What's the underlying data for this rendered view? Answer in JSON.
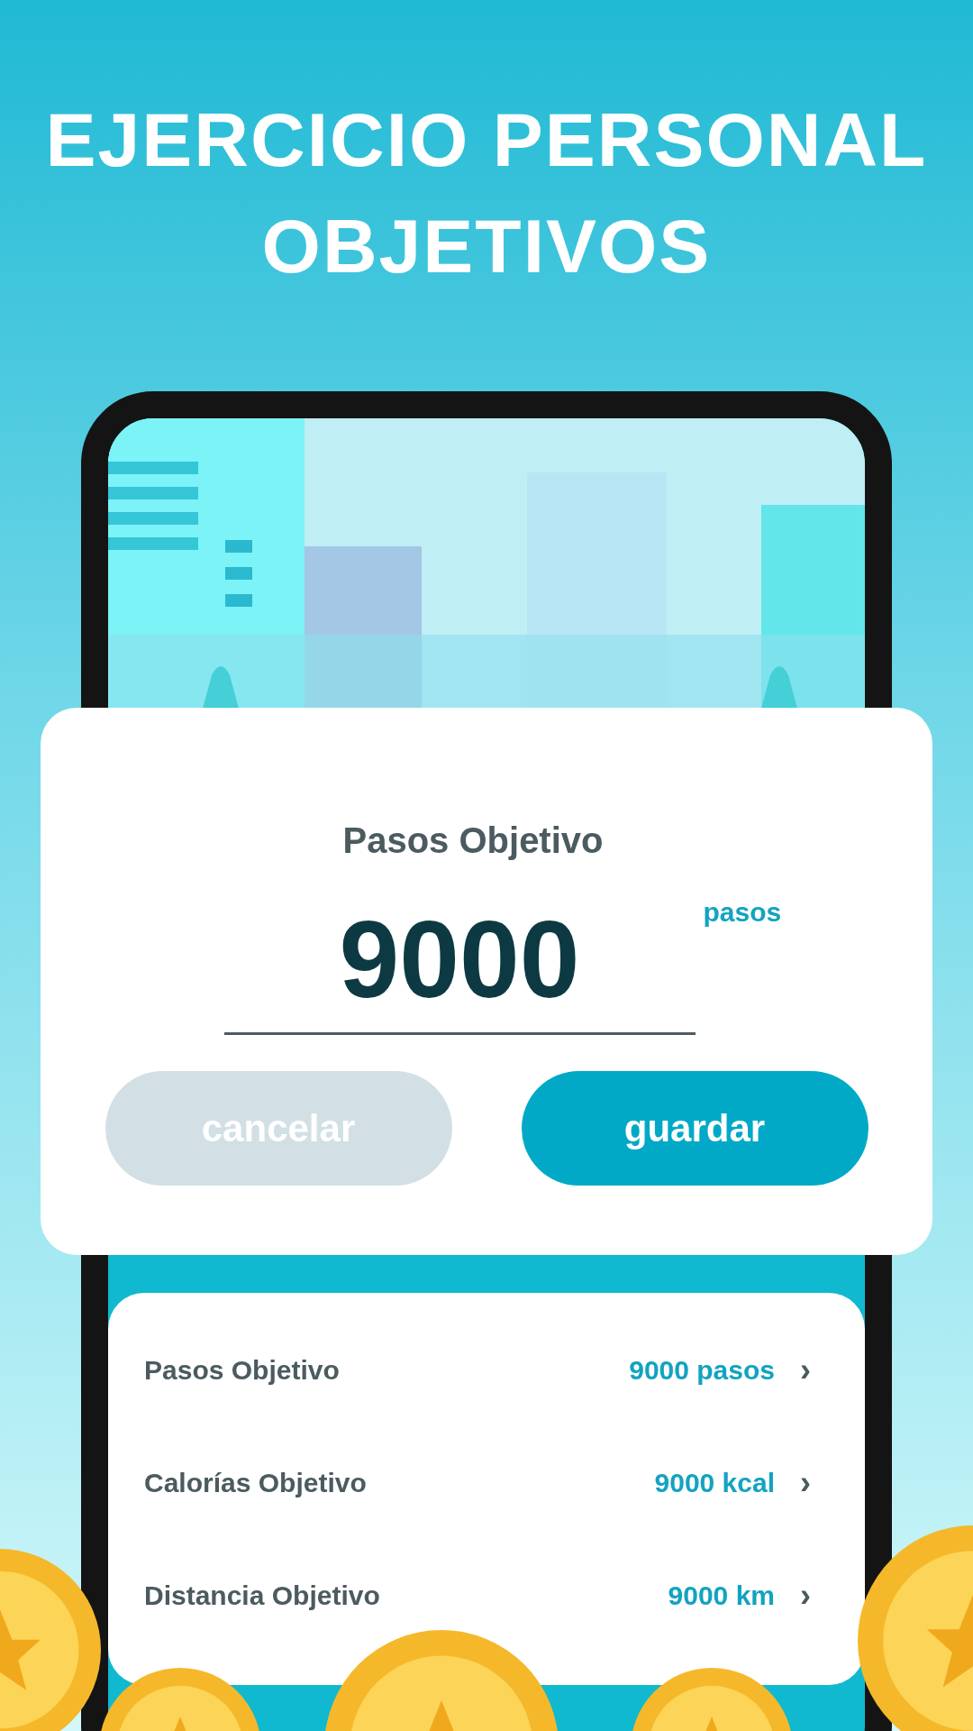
{
  "headline": [
    "EJERCICIO PERSONAL",
    "OBJETIVOS"
  ],
  "dialog": {
    "title": "Pasos Objetivo",
    "value": "9000",
    "unit": "pasos",
    "buttons": [
      {
        "label": "cancelar",
        "kind": "secondary"
      },
      {
        "label": "guardar",
        "kind": "primary"
      }
    ]
  },
  "goals": [
    {
      "label": "Pasos Objetivo",
      "value": "9000 pasos",
      "chevron": "›"
    },
    {
      "label": "Calorías Objetivo",
      "value": "9000 kcal",
      "chevron": "›"
    },
    {
      "label": "Distancia Objetivo",
      "value": "9000 km",
      "chevron": "›"
    }
  ]
}
